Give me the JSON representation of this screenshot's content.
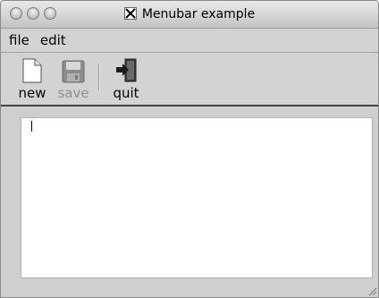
{
  "window": {
    "title": "Menubar example",
    "title_icon": "x11-icon",
    "buttons": [
      "close",
      "minimize",
      "zoom"
    ]
  },
  "menubar": {
    "items": [
      {
        "label": "file"
      },
      {
        "label": "edit"
      }
    ]
  },
  "toolbar": {
    "new_label": "new",
    "new_icon": "document-icon",
    "save_label": "save",
    "save_icon": "floppy-disk-icon",
    "save_enabled": false,
    "quit_label": "quit",
    "quit_icon": "exit-door-icon"
  },
  "editor": {
    "content": ""
  }
}
